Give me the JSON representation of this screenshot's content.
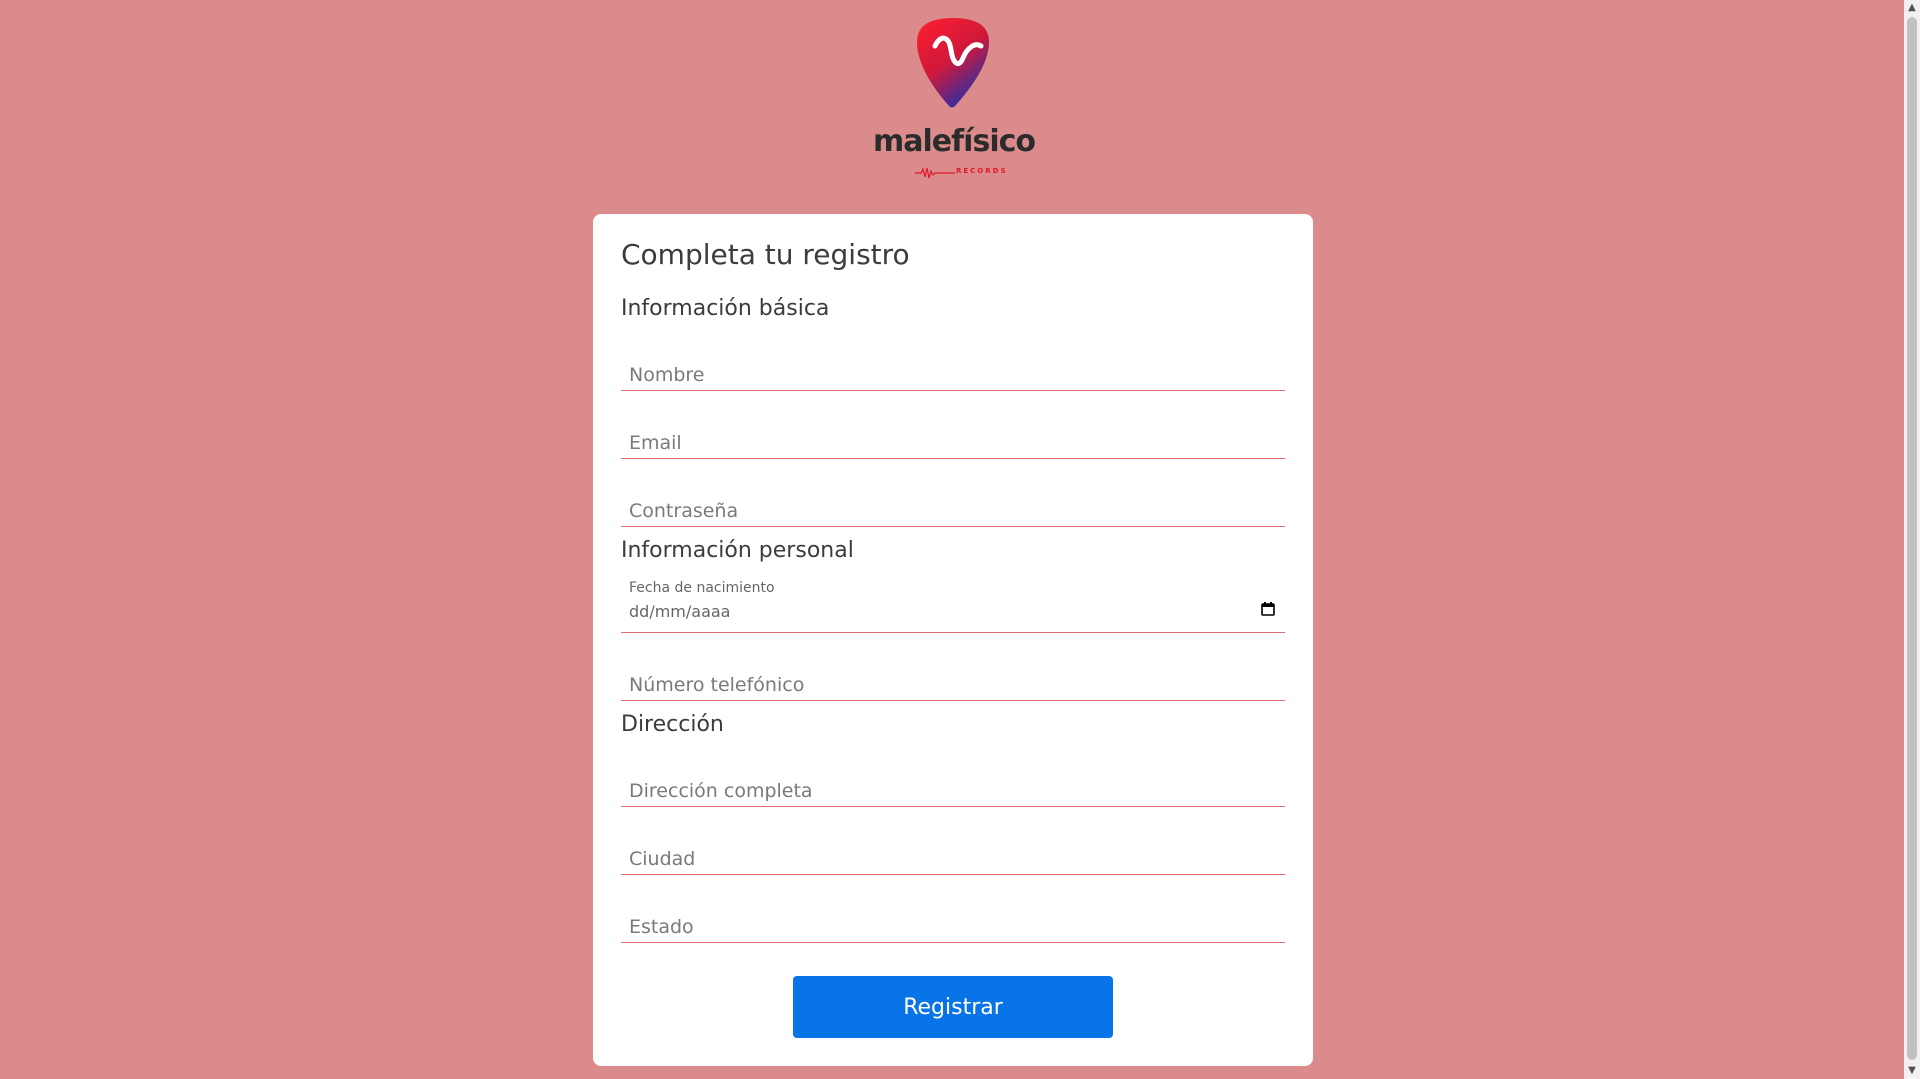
{
  "brand": {
    "name": "malefísico",
    "sub": "RECORDS",
    "colors": {
      "primary": "#e2162b",
      "secondary": "#2e2fa0",
      "background": "#db8b8c",
      "button": "#0874e8"
    }
  },
  "form": {
    "title": "Completa tu registro",
    "sections": {
      "basic": "Información básica",
      "personal": "Información personal",
      "address": "Dirección"
    },
    "fields": {
      "name_placeholder": "Nombre",
      "email_placeholder": "Email",
      "password_placeholder": "Contraseña",
      "birthdate_label": "Fecha de nacimiento",
      "birthdate_value": "dd/mm/aaaa",
      "phone_placeholder": "Número telefónico",
      "address_placeholder": "Dirección completa",
      "city_placeholder": "Ciudad",
      "state_placeholder": "Estado"
    },
    "submit_label": "Registrar"
  },
  "icons": {
    "calendar": "calendar-icon",
    "scroll_up": "chevron-up-icon",
    "scroll_down": "chevron-down-icon"
  }
}
